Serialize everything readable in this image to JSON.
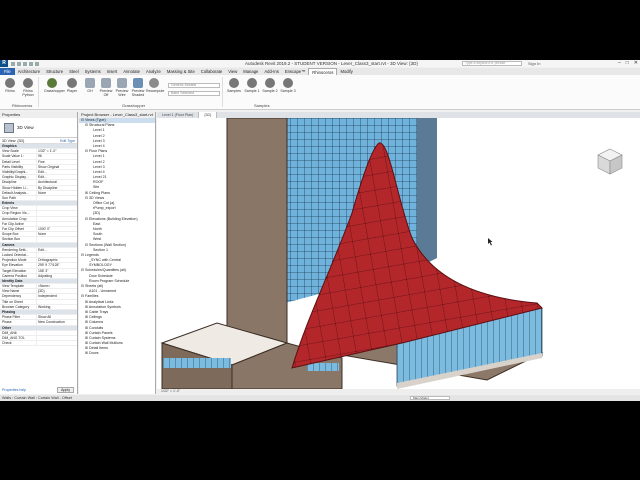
{
  "app": {
    "logo": "R",
    "title": "Autodesk Revit 2019.2 - STUDENT VERSION - Lever_Class3_start.rvt - 3D View: {3D}",
    "search_placeholder": "Type a keyword or phrase",
    "signin": "Sign In",
    "win_min": "–",
    "win_max": "□",
    "win_close": "✕"
  },
  "ribbon_tabs": [
    {
      "label": "File",
      "kind": "file"
    },
    {
      "label": "Architecture"
    },
    {
      "label": "Structure"
    },
    {
      "label": "Steel"
    },
    {
      "label": "Systems"
    },
    {
      "label": "Insert"
    },
    {
      "label": "Annotate"
    },
    {
      "label": "Analyze"
    },
    {
      "label": "Massing & Site"
    },
    {
      "label": "Collaborate"
    },
    {
      "label": "View"
    },
    {
      "label": "Manage"
    },
    {
      "label": "Add-Ins"
    },
    {
      "label": "Enscape™"
    },
    {
      "label": "Rhinoceros",
      "kind": "active"
    },
    {
      "label": "Modify"
    }
  ],
  "ribbon": {
    "buttons": [
      "Rhino",
      "Rhino Python",
      "Grasshopper",
      "Player",
      "GH",
      "Preview Off",
      "Preview Wire",
      "Preview Shaded",
      "Recompute"
    ],
    "combo1": "Generic Models",
    "combo2": "Bake Selected",
    "samples": [
      "Samples",
      "Sample 1",
      "Sample 2",
      "Sample 3"
    ],
    "panel_rhinoceros": "Rhinoceros",
    "panel_grasshopper": "Grasshopper",
    "panel_samples": "Samples"
  },
  "properties": {
    "header": "Properties",
    "type_name": "3D View",
    "selector": "3D View: {3D}",
    "edit_type": "Edit Type",
    "rows": [
      {
        "k": "Graphics",
        "v": "",
        "group": true
      },
      {
        "k": "View Scale",
        "v": "1/32\" = 1'-0\""
      },
      {
        "k": "Scale Value 1:",
        "v": "96"
      },
      {
        "k": "Detail Level",
        "v": "Fine"
      },
      {
        "k": "Parts Visibility",
        "v": "Show Original"
      },
      {
        "k": "Visibility/Graphi...",
        "v": "Edit..."
      },
      {
        "k": "Graphic Display...",
        "v": "Edit..."
      },
      {
        "k": "Discipline",
        "v": "Architectural"
      },
      {
        "k": "Show Hidden Li...",
        "v": "By Discipline"
      },
      {
        "k": "Default Analysis...",
        "v": "None"
      },
      {
        "k": "Sun Path",
        "v": ""
      },
      {
        "k": "Extents",
        "v": "",
        "group": true
      },
      {
        "k": "Crop View",
        "v": ""
      },
      {
        "k": "Crop Region Vis...",
        "v": ""
      },
      {
        "k": "Annotation Crop",
        "v": ""
      },
      {
        "k": "Far Clip Active",
        "v": ""
      },
      {
        "k": "Far Clip Offset",
        "v": "1000' 0\""
      },
      {
        "k": "Scope Box",
        "v": "None"
      },
      {
        "k": "Section Box",
        "v": ""
      },
      {
        "k": "Camera",
        "v": "",
        "group": true
      },
      {
        "k": "Rendering Setti...",
        "v": "Edit..."
      },
      {
        "k": "Locked Orientat...",
        "v": ""
      },
      {
        "k": "Projection Mode",
        "v": "Orthographic"
      },
      {
        "k": "Eye Elevation",
        "v": "295' 9 77/128\""
      },
      {
        "k": "Target Elevation",
        "v": "158' 3\""
      },
      {
        "k": "Camera Position",
        "v": "Adjusting"
      },
      {
        "k": "Identity Data",
        "v": "",
        "group": true
      },
      {
        "k": "View Template",
        "v": "<None>"
      },
      {
        "k": "View Name",
        "v": "{3D}"
      },
      {
        "k": "Dependency",
        "v": "Independent"
      },
      {
        "k": "Title on Sheet",
        "v": ""
      },
      {
        "k": "Browser Category",
        "v": "Working"
      },
      {
        "k": "Phasing",
        "v": "",
        "group": true
      },
      {
        "k": "Phase Filter",
        "v": "Show All"
      },
      {
        "k": "Phase",
        "v": "New Construction"
      },
      {
        "k": "Other",
        "v": "",
        "group": true
      },
      {
        "k": "DIM_AN6",
        "v": ""
      },
      {
        "k": "DIM_ANG TOL",
        "v": ""
      },
      {
        "k": "Check",
        "v": ""
      }
    ],
    "help": "Properties help",
    "apply": "Apply"
  },
  "browser": {
    "header": "Project Browser - Lever_Class3_start.rvt",
    "items": [
      {
        "label": "⊟ Views (Type)",
        "d": 0,
        "hl": true
      },
      {
        "label": "⊟ Structural Plans",
        "d": 1
      },
      {
        "label": "Level 1",
        "d": 3
      },
      {
        "label": "Level 2",
        "d": 3
      },
      {
        "label": "Level 3",
        "d": 3
      },
      {
        "label": "Level 4",
        "d": 3
      },
      {
        "label": "⊟ Floor Plans",
        "d": 1
      },
      {
        "label": "Level 1",
        "d": 3
      },
      {
        "label": "Level 2",
        "d": 3
      },
      {
        "label": "Level 3",
        "d": 3
      },
      {
        "label": "Level 4",
        "d": 3
      },
      {
        "label": "Level 21",
        "d": 3
      },
      {
        "label": "ROOF",
        "d": 3
      },
      {
        "label": "Site",
        "d": 3
      },
      {
        "label": "⊞ Ceiling Plans",
        "d": 1
      },
      {
        "label": "⊟ 3D Views",
        "d": 1
      },
      {
        "label": "Office Cut {a}",
        "d": 3
      },
      {
        "label": "rPump_export",
        "d": 3
      },
      {
        "label": "{3D}",
        "d": 3
      },
      {
        "label": "⊟ Elevations (Building Elevation)",
        "d": 1
      },
      {
        "label": "East",
        "d": 3
      },
      {
        "label": "North",
        "d": 3
      },
      {
        "label": "South",
        "d": 3
      },
      {
        "label": "West",
        "d": 3
      },
      {
        "label": "⊟ Sections (Wall Section)",
        "d": 1
      },
      {
        "label": "Section 1",
        "d": 3
      },
      {
        "label": "⊟ Legends",
        "d": 0
      },
      {
        "label": "_SYNC with Central",
        "d": 2
      },
      {
        "label": "SYMBOLOGY",
        "d": 2
      },
      {
        "label": "⊟ Schedules/Quantities (all)",
        "d": 0
      },
      {
        "label": "Door Schedule",
        "d": 2
      },
      {
        "label": "Room Program Schedule",
        "d": 2
      },
      {
        "label": "⊟ Sheets (all)",
        "d": 0
      },
      {
        "label": "A101 - Unnamed",
        "d": 2
      },
      {
        "label": "⊟ Families",
        "d": 0
      },
      {
        "label": "⊞ Analytical Links",
        "d": 1
      },
      {
        "label": "⊞ Annotation Symbols",
        "d": 1
      },
      {
        "label": "⊞ Cable Trays",
        "d": 1
      },
      {
        "label": "⊞ Ceilings",
        "d": 1
      },
      {
        "label": "⊞ Columns",
        "d": 1
      },
      {
        "label": "⊞ Conduits",
        "d": 1
      },
      {
        "label": "⊞ Curtain Panels",
        "d": 1
      },
      {
        "label": "⊞ Curtain Systems",
        "d": 1
      },
      {
        "label": "⊞ Curtain Wall Mullions",
        "d": 1
      },
      {
        "label": "⊞ Detail Items",
        "d": 1
      },
      {
        "label": "⊞ Doors",
        "d": 1
      }
    ]
  },
  "view_tabs": [
    "Level 1 (Floor Plan)",
    "{3D}"
  ],
  "viewbar": "1/32\" = 1'-0\"",
  "status": {
    "text": "Walls : Curtain Wall : Curtain Wall - Offset",
    "workset": "Main Model"
  },
  "colors": {
    "canopy": "#b3262a",
    "tower": "#8a7666",
    "podium": "#7e6a5b",
    "glass": "#5fa8d3"
  }
}
